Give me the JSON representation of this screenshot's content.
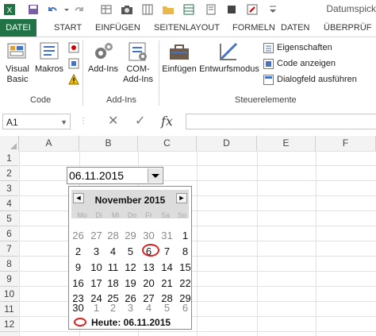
{
  "qat": {
    "icons": [
      "excel-logo-icon",
      "save-icon",
      "undo-icon",
      "redo-icon",
      "table-icon",
      "camera-icon",
      "grid-icon",
      "folder-icon",
      "spreadsheet-icon",
      "form-icon",
      "stop-icon",
      "form-edit-icon",
      "separator-icon"
    ],
    "doc_title": "Datumspick"
  },
  "tabs": [
    "DATEI",
    "START",
    "EINFÜGEN",
    "SEITENLAYOUT",
    "FORMELN",
    "DATEN",
    "ÜBERPRÜF"
  ],
  "ribbon": {
    "code_group": {
      "label": "Code",
      "visual_basic": "Visual\nBasic",
      "macros": "Makros"
    },
    "addins_group": {
      "label": "Add-Ins",
      "addins": "Add-Ins",
      "com_addins": "COM-\nAdd-Ins"
    },
    "controls_group": {
      "label": "Steuerelemente",
      "insert": "Einfügen",
      "design_mode": "Entwurfsmodus",
      "properties": "Eigenschaften",
      "view_code": "Code anzeigen",
      "run_dialog": "Dialogfeld ausführen"
    }
  },
  "formula_bar": {
    "name_box": "A1",
    "cancel_symbol": "✕",
    "enter_symbol": "✓",
    "fx_symbol": "fx",
    "formula": ""
  },
  "grid": {
    "columns": [
      "A",
      "B",
      "C",
      "D",
      "E",
      "F"
    ],
    "rows": [
      "1",
      "2",
      "3",
      "4",
      "5",
      "6",
      "7",
      "8",
      "9",
      "10",
      "11",
      "12"
    ]
  },
  "combo": {
    "value": "06.11.2015"
  },
  "calendar": {
    "month_title": "November 2015",
    "prev_label": "◄",
    "next_label": "►",
    "weekdays": [
      "Mo",
      "Di",
      "Mi",
      "Do",
      "Fr",
      "Sa",
      "So"
    ],
    "weeks": [
      [
        "26",
        "27",
        "28",
        "29",
        "30",
        "31",
        "1"
      ],
      [
        "2",
        "3",
        "4",
        "5",
        "6",
        "7",
        "8"
      ],
      [
        "9",
        "10",
        "11",
        "12",
        "13",
        "14",
        "15"
      ],
      [
        "16",
        "17",
        "18",
        "19",
        "20",
        "21",
        "22"
      ],
      [
        "23",
        "24",
        "25",
        "26",
        "27",
        "28",
        "29"
      ],
      [
        "30",
        "1",
        "2",
        "3",
        "4",
        "5",
        "6"
      ]
    ],
    "today_label": "Heute: 06.11.2015",
    "colors": {
      "accent": "#d82020",
      "header": "#dcdcdc",
      "excel_green": "#217346"
    }
  }
}
